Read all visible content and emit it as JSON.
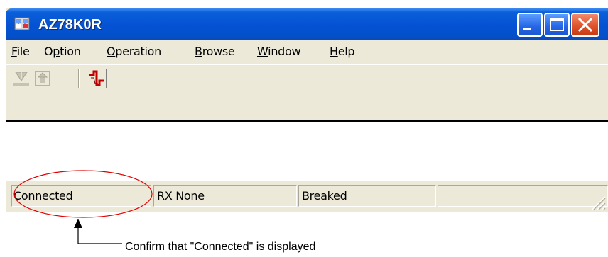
{
  "window": {
    "title": "AZ78K0R",
    "title_bar_color": "#0553d4",
    "close_button_color": "#e0532b"
  },
  "menu": {
    "items": [
      {
        "label": "File",
        "accel": "F"
      },
      {
        "label": "Option",
        "accel": "p"
      },
      {
        "label": "Operation",
        "accel": "O"
      },
      {
        "label": "Browse",
        "accel": "B"
      },
      {
        "label": "Window",
        "accel": "W"
      },
      {
        "label": "Help",
        "accel": "H"
      }
    ]
  },
  "toolbar": {
    "buttons": [
      {
        "icon": "download-icon",
        "enabled": false
      },
      {
        "icon": "upload-icon",
        "enabled": false
      },
      {
        "icon": "signal-pulse-icon",
        "enabled": true,
        "color": "#c00000"
      }
    ]
  },
  "status_bar": {
    "panels": [
      "Connected",
      "RX None",
      "Breaked",
      ""
    ]
  },
  "annotation": {
    "caption": "Confirm that \"Connected\" is displayed",
    "highlight_color": "#e00000"
  }
}
